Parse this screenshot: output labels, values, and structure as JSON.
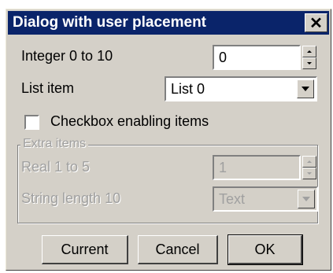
{
  "window": {
    "title": "Dialog with user placement",
    "close_symbol": "✕"
  },
  "integer": {
    "label": "Integer 0 to 10",
    "value": "0"
  },
  "list": {
    "label": "List item",
    "value": "List 0"
  },
  "checkbox": {
    "label": "Checkbox enabling items",
    "checked": false
  },
  "group": {
    "title": "Extra items",
    "real": {
      "label": "Real 1 to 5",
      "value": "1"
    },
    "string": {
      "label": "String length 10",
      "value": "Text"
    }
  },
  "buttons": {
    "current": "Current",
    "cancel": "Cancel",
    "ok": "OK"
  },
  "colors": {
    "title_bar": "#0a246a",
    "dialog_face": "#d4d0c8",
    "disabled_text": "#a0a0a0"
  }
}
